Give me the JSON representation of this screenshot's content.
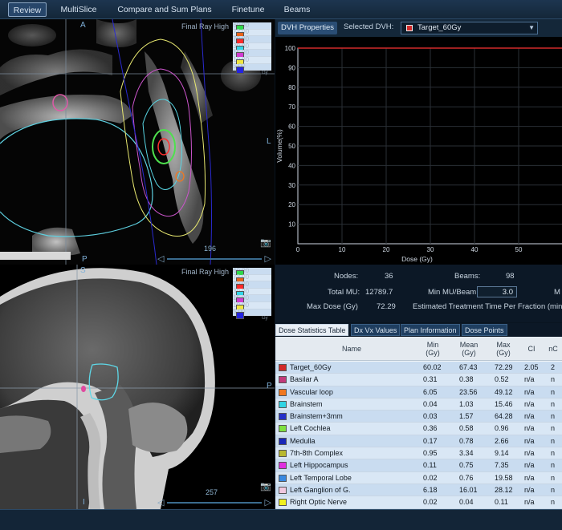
{
  "menu": {
    "tabs": [
      "Review",
      "MultiSlice",
      "Compare and Sum Plans",
      "Finetune",
      "Beams"
    ]
  },
  "viewer_top": {
    "orient_top": "A",
    "orient_right": "L",
    "orient_bottom": "P",
    "title": "Final Ray High",
    "slider_value": "196"
  },
  "viewer_bottom": {
    "orient_top": "S",
    "orient_right": "P",
    "orient_bottom": "I",
    "title": "Final Ray High",
    "slider_value": "257"
  },
  "dose_legend": {
    "levels": [
      "60.00",
      "72.00",
      "70.00",
      "30.00",
      "15.00",
      "10.00",
      "5.00"
    ],
    "colors": [
      "#2fd84a",
      "#e8641c",
      "#ff2a2a",
      "#32d6e8",
      "#d13cd1",
      "#f0e640",
      "#2424e0"
    ],
    "unit": "Gy"
  },
  "dvh": {
    "properties_tab": "DVH Properties",
    "selected_label": "Selected DVH:",
    "selected_value": "Target_60Gy",
    "selected_color": "#d12a2a"
  },
  "chart_data": {
    "type": "line",
    "xlabel": "Dose (Gy)",
    "ylabel": "Volume(%)",
    "xlim": [
      0,
      60
    ],
    "ylim": [
      0,
      100
    ],
    "xticks": [
      0,
      10,
      20,
      30,
      40,
      50
    ],
    "yticks": [
      10,
      20,
      30,
      40,
      50,
      60,
      70,
      80,
      90,
      100
    ],
    "grid": true,
    "series": [
      {
        "color": "#d12a2a",
        "x": [
          0,
          60
        ],
        "y": [
          100,
          100
        ]
      }
    ]
  },
  "stats": {
    "nodes_label": "Nodes:",
    "nodes_value": "36",
    "beams_label": "Beams:",
    "beams_value": "98",
    "total_mu_label": "Total MU:",
    "total_mu_value": "12789.7",
    "min_mu_label": "Min MU/Beam:",
    "min_mu_value": "3.0",
    "max_label_cut": "M",
    "max_dose_label": "Max Dose (Gy)",
    "max_dose_value": "72.29",
    "est_time_label": "Estimated Treatment Time Per Fraction (min"
  },
  "table_tabs": [
    "Dose Statistics Table",
    "Dx Vx Values",
    "Plan Information",
    "Dose Points"
  ],
  "table": {
    "headers": {
      "name": "Name",
      "min": "Min",
      "min_u": "(Gy)",
      "mean": "Mean",
      "mean_u": "(Gy)",
      "max": "Max",
      "max_u": "(Gy)",
      "ci": "CI",
      "nci": "nC"
    },
    "rows": [
      {
        "color": "#d12a2a",
        "name": "Target_60Gy",
        "min": "60.02",
        "mean": "67.43",
        "max": "72.29",
        "ci": "2.05",
        "nci": "2"
      },
      {
        "color": "#c23a7a",
        "name": "Basilar A",
        "min": "0.31",
        "mean": "0.38",
        "max": "0.52",
        "ci": "n/a",
        "nci": "n"
      },
      {
        "color": "#f07820",
        "name": "Vascular loop",
        "min": "6.05",
        "mean": "23.56",
        "max": "49.12",
        "ci": "n/a",
        "nci": "n"
      },
      {
        "color": "#30d4e4",
        "name": "Brainstem",
        "min": "0.04",
        "mean": "1.03",
        "max": "15.46",
        "ci": "n/a",
        "nci": "n"
      },
      {
        "color": "#2430c8",
        "name": "Brainstem+3mm",
        "min": "0.03",
        "mean": "1.57",
        "max": "64.28",
        "ci": "n/a",
        "nci": "n"
      },
      {
        "color": "#7ee040",
        "name": "Left Cochlea",
        "min": "0.36",
        "mean": "0.58",
        "max": "0.96",
        "ci": "n/a",
        "nci": "n"
      },
      {
        "color": "#1a28b8",
        "name": "Medulla",
        "min": "0.17",
        "mean": "0.78",
        "max": "2.66",
        "ci": "n/a",
        "nci": "n"
      },
      {
        "color": "#b8b830",
        "name": "7th-8th Complex",
        "min": "0.95",
        "mean": "3.34",
        "max": "9.14",
        "ci": "n/a",
        "nci": "n"
      },
      {
        "color": "#e030e0",
        "name": "Left Hippocampus",
        "min": "0.11",
        "mean": "0.75",
        "max": "7.35",
        "ci": "n/a",
        "nci": "n"
      },
      {
        "color": "#3888e0",
        "name": "Left Temporal Lobe",
        "min": "0.02",
        "mean": "0.76",
        "max": "19.58",
        "ci": "n/a",
        "nci": "n"
      },
      {
        "color": "#f0c8e0",
        "name": "Left Ganglion of G.",
        "min": "6.18",
        "mean": "16.01",
        "max": "28.12",
        "ci": "n/a",
        "nci": "n"
      },
      {
        "color": "#f0f020",
        "name": "Right Optic Nerve",
        "min": "0.02",
        "mean": "0.04",
        "max": "0.11",
        "ci": "n/a",
        "nci": "n"
      }
    ]
  }
}
